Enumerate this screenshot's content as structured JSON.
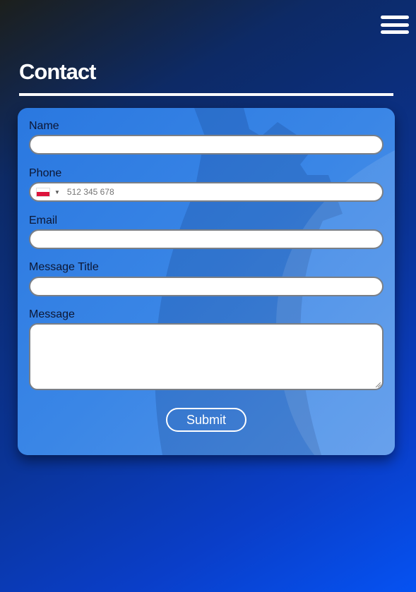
{
  "header": {
    "title": "Contact",
    "menu_icon": "hamburger-menu-icon"
  },
  "form": {
    "fields": [
      {
        "label": "Name",
        "value": "",
        "placeholder": ""
      },
      {
        "label": "Phone",
        "value": "",
        "placeholder": "512 345 678",
        "country_flag": "poland-flag-icon"
      },
      {
        "label": "Email",
        "value": "",
        "placeholder": ""
      },
      {
        "label": "Message Title",
        "value": "",
        "placeholder": ""
      },
      {
        "label": "Message",
        "value": "",
        "placeholder": ""
      }
    ],
    "submit_label": "Submit"
  },
  "colors": {
    "background_dark": "#0d2a66",
    "background_bright": "#0552f2",
    "card": "#3a86e6",
    "label_text": "#0c1633",
    "flag_red": "#dc143c"
  }
}
